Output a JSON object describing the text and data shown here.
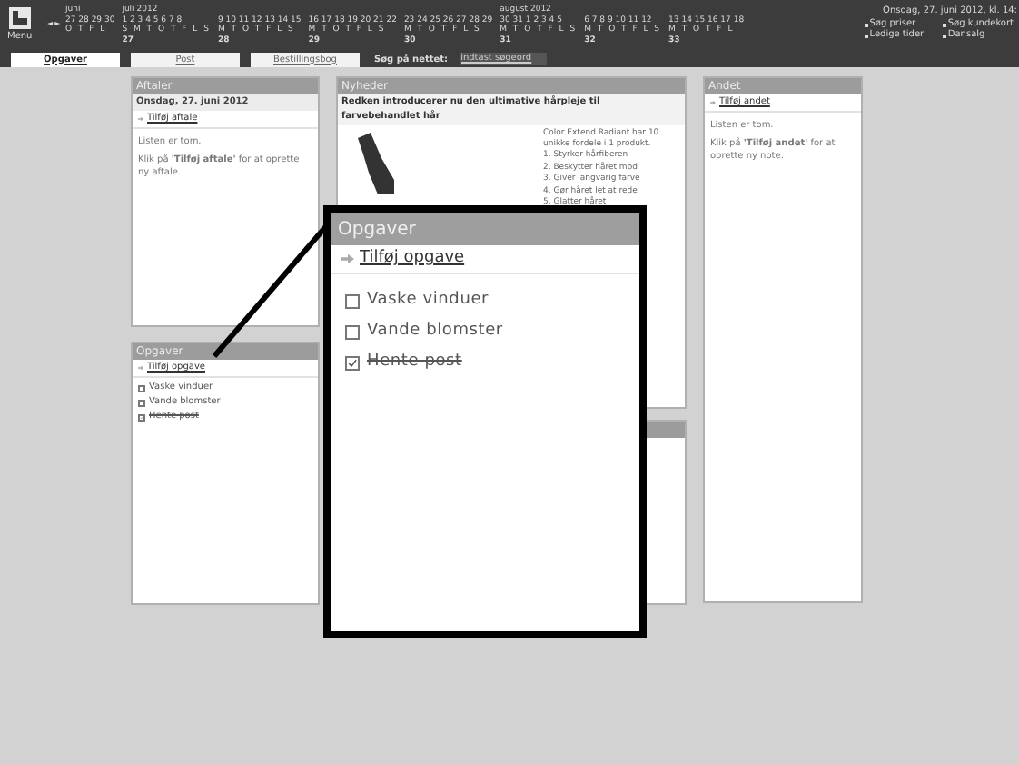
{
  "topbar": {
    "menu_label": "Menu",
    "prev": "◄",
    "next": "►",
    "weeks": [
      {
        "month": "juni",
        "days": "27 28 29 30",
        "weekdays": "O T F L"
      },
      {
        "month": "juli 2012",
        "days": "1 2 3 4 5 6 7 8",
        "weekdays": "S M T O T F L S",
        "number": "27"
      },
      {
        "days": "9 10 11 12 13 14 15",
        "weekdays": "M T O T F L S",
        "number": "28"
      },
      {
        "days": "16 17 18 19 20 21 22",
        "weekdays": "M T O T F L S",
        "number": "29"
      },
      {
        "days": "23 24 25 26 27 28 29",
        "weekdays": "M T O T F L S",
        "number": "30"
      },
      {
        "month": "august 2012",
        "days": "30 31 1 2 3 4 5",
        "weekdays": "M T O T F L S",
        "number": "31"
      },
      {
        "days": "6 7 8 9 10 11 12",
        "weekdays": "M T O T F L S",
        "number": "32"
      },
      {
        "days": "13 14 15 16 17 18",
        "weekdays": "M T O T F L",
        "number": "33"
      }
    ],
    "date_line": "Onsdag, 27. juni 2012, kl. 14:",
    "quick_links": [
      "Søg priser",
      "Søg kundekort",
      "Ledige tider",
      "Dansalg"
    ]
  },
  "tabs": [
    {
      "label": "Opgaver",
      "selected": true
    },
    {
      "label": "Post",
      "selected": false
    },
    {
      "label": "Bestillingsbog",
      "selected": false
    }
  ],
  "web_search": {
    "label": "Søg på nettet:",
    "placeholder": "indtast søgeord"
  },
  "appointments": {
    "title": "Aftaler",
    "date": "Onsdag, 27. juni 2012",
    "add_link": "Tilføj aftale",
    "empty": "Listen er tom.",
    "hint": "Klik på **'Tilføj aftale'** for at oprette ny aftale."
  },
  "news": {
    "title": "Nyheder",
    "headline": "Redken introducerer nu den ultimative hårpleje til farvebehandlet hår",
    "intro": "Color Extend Radiant har 10 unikke fordele i 1 produkt.",
    "points": [
      "1. Styrker hårfiberen",
      "2. Beskytter håret mod",
      "3. Giver langvarig farve",
      "4. Gør håret let at rede",
      "5. Glatter håret"
    ]
  },
  "tasks_panel": {
    "title": "Opgaver",
    "add_link": "Tilføj opgave",
    "tasks": [
      {
        "label": "Vaske vinduer",
        "checked": false
      },
      {
        "label": "Vande blomster",
        "checked": false
      },
      {
        "label": "Hente post",
        "checked": true
      }
    ]
  },
  "other": {
    "title": "Andet",
    "add_link": "Tilføj andet",
    "empty": "Listen er tom.",
    "hint": "Klik på **'Tilføj andet'** for at oprette ny note."
  },
  "callout": {
    "title": "Opgaver",
    "add_link": "Tilføj opgave",
    "tasks": [
      {
        "label": "Vaske vinduer",
        "checked": false
      },
      {
        "label": "Vande blomster",
        "checked": false
      },
      {
        "label": "Hente post",
        "checked": true
      }
    ]
  }
}
